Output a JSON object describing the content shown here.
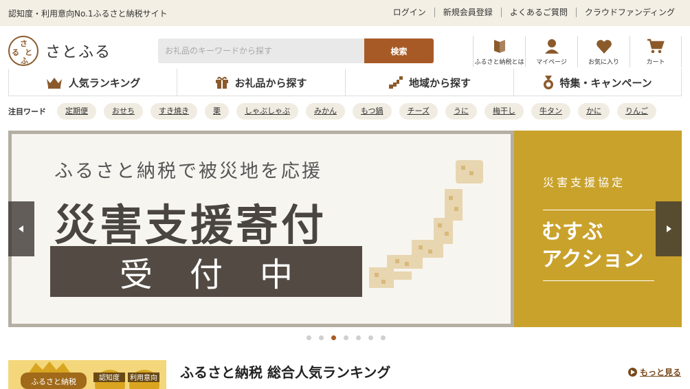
{
  "topbar": {
    "tagline": "認知度・利用意向No.1ふるさと納税サイト",
    "links": [
      "ログイン",
      "新規会員登録",
      "よくあるご質問",
      "クラウドファンディング"
    ]
  },
  "logo": {
    "name": "さとふる",
    "mark_chars": [
      "さ",
      "と",
      "ふ",
      "る"
    ]
  },
  "search": {
    "placeholder": "お礼品のキーワードから探す",
    "button": "検索"
  },
  "icon_nav": [
    {
      "label": "ふるさと納税とは",
      "icon": "book-icon"
    },
    {
      "label": "マイページ",
      "icon": "user-icon"
    },
    {
      "label": "お気に入り",
      "icon": "heart-icon"
    },
    {
      "label": "カート",
      "icon": "cart-icon"
    }
  ],
  "category_nav": [
    {
      "label": "人気ランキング",
      "icon": "crown-icon"
    },
    {
      "label": "お礼品から探す",
      "icon": "gift-icon"
    },
    {
      "label": "地域から探す",
      "icon": "japan-map-icon"
    },
    {
      "label": "特集・キャンペーン",
      "icon": "medal-icon"
    }
  ],
  "keywords": {
    "label": "注目ワード",
    "items": [
      "定期便",
      "おせち",
      "すき焼き",
      "栗",
      "しゃぶしゃぶ",
      "みかん",
      "もつ鍋",
      "チーズ",
      "うに",
      "梅干し",
      "牛タン",
      "かに",
      "りんご"
    ]
  },
  "hero": {
    "subtitle": "ふるさと納税で被災地を応援",
    "title": "災害支援寄付",
    "band": "受付中",
    "side_title": "災害支援協定",
    "side_line1": "むすぶ",
    "side_line2": "アクション",
    "dots_count": 7,
    "active_dot": 2
  },
  "ranking": {
    "banner_text_1": "ふるさと納税",
    "banner_text_2": "認知度",
    "banner_text_3": "利用意向",
    "title": "ふるさと納税 総合人気ランキング",
    "more": "もっと見る"
  },
  "colors": {
    "accent": "#a85a26",
    "topbar_bg": "#f4efe4",
    "gold": "#c9a22c"
  }
}
